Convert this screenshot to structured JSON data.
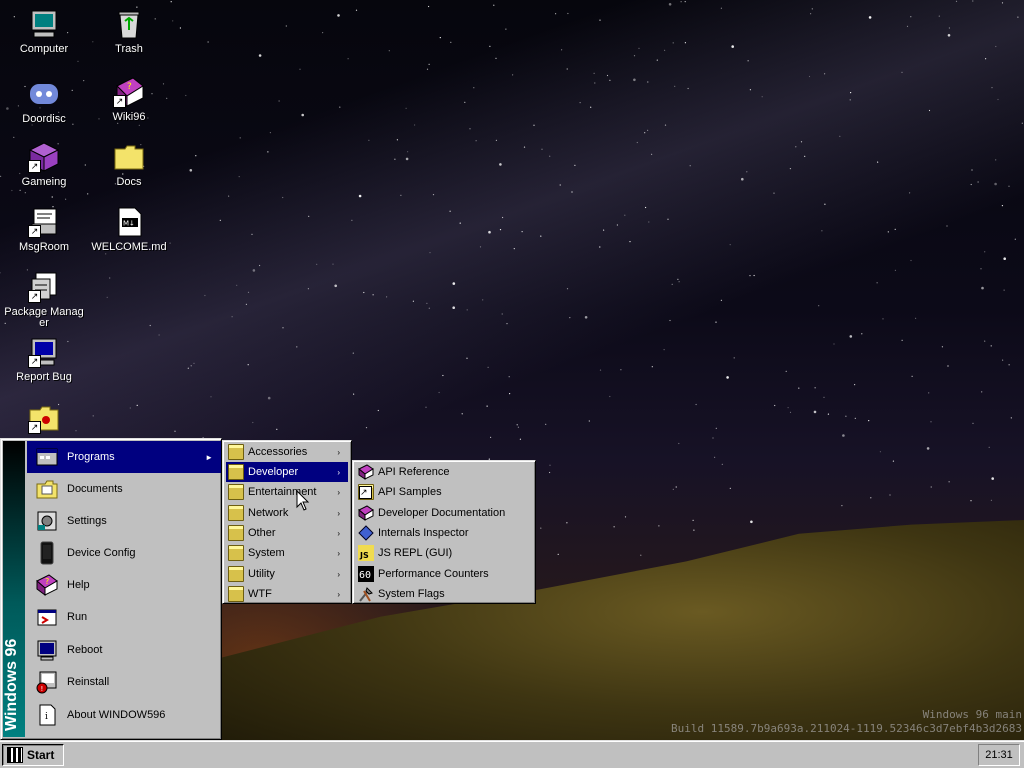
{
  "desktop": {
    "icons": [
      {
        "label": "Computer",
        "icon": "computer-icon"
      },
      {
        "label": "Trash",
        "icon": "trash-icon"
      },
      {
        "label": "Doordisc",
        "icon": "discord-icon"
      },
      {
        "label": "Wiki96",
        "icon": "book-icon"
      },
      {
        "label": "Gameing",
        "icon": "game-cube-icon"
      },
      {
        "label": "Docs",
        "icon": "folder-icon"
      },
      {
        "label": "MsgRoom",
        "icon": "chat-icon"
      },
      {
        "label": "WELCOME.md",
        "icon": "markdown-file-icon"
      },
      {
        "label": "Package Manager",
        "icon": "package-icon"
      },
      {
        "label": "Report Bug",
        "icon": "bug-report-icon"
      }
    ],
    "build_line1": "Windows 96 main",
    "build_line2": "Build 11589.7b9a693a.211024-1119.52346c3d7ebf4b3d2683"
  },
  "start_menu": {
    "banner": "Windows 96",
    "items": [
      {
        "label": "Programs",
        "icon": "programs-icon"
      },
      {
        "label": "Documents",
        "icon": "documents-folder-icon"
      },
      {
        "label": "Settings",
        "icon": "settings-icon"
      },
      {
        "label": "Device Config",
        "icon": "device-icon"
      },
      {
        "label": "Help",
        "icon": "help-book-icon"
      },
      {
        "label": "Run",
        "icon": "run-icon"
      },
      {
        "label": "Reboot",
        "icon": "reboot-icon"
      },
      {
        "label": "Reinstall",
        "icon": "reinstall-icon"
      },
      {
        "label": "About WINDOW596",
        "icon": "about-icon"
      }
    ]
  },
  "programs_menu": {
    "items": [
      "Accessories",
      "Developer",
      "Entertainment",
      "Network",
      "Other",
      "System",
      "Utility",
      "WTF"
    ]
  },
  "developer_menu": {
    "items": [
      {
        "label": "API Reference",
        "icon": "book-icon"
      },
      {
        "label": "API Samples",
        "icon": "folder-shortcut-icon"
      },
      {
        "label": "Developer Documentation",
        "icon": "book-icon"
      },
      {
        "label": "Internals Inspector",
        "icon": "diamond-icon"
      },
      {
        "label": "JS REPL (GUI)",
        "icon": "js-icon"
      },
      {
        "label": "Performance Counters",
        "icon": "counter-icon"
      },
      {
        "label": "System Flags",
        "icon": "tools-icon"
      }
    ]
  },
  "taskbar": {
    "start_label": "Start",
    "clock": "21:31"
  },
  "colors": {
    "highlight": "#000080",
    "face": "#c0c0c0"
  }
}
